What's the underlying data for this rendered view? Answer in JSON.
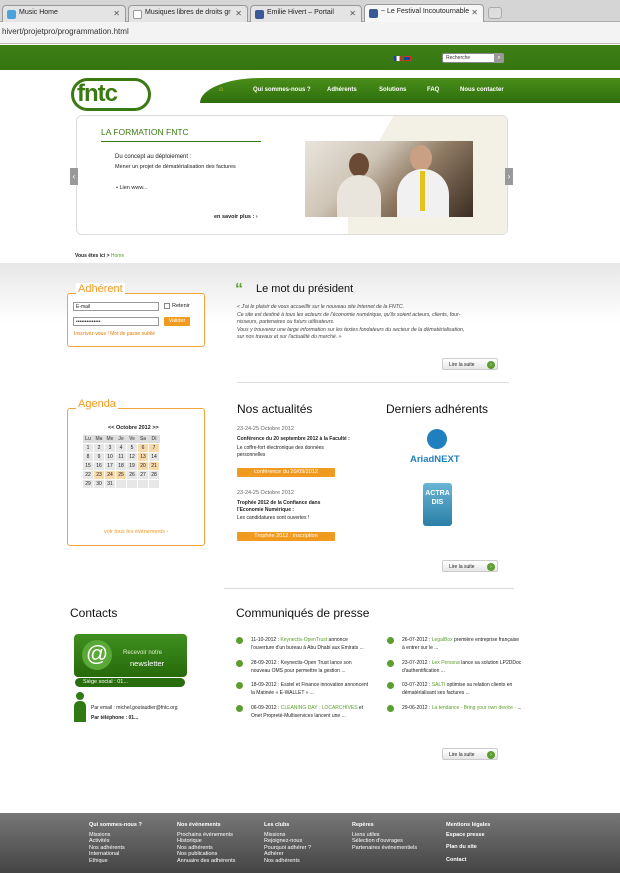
{
  "browser": {
    "tabs": [
      {
        "label": "Music Home",
        "color": "#4aa3df"
      },
      {
        "label": "Musiques libres de droits gr",
        "color": "#ffffff"
      },
      {
        "label": "Emilie Hivert – Portail",
        "color": "#3b5998"
      },
      {
        "label": "~ Le Festival Incoutournable",
        "color": "#3b5998"
      }
    ],
    "url": "hivert/projetpro/programmation.html"
  },
  "header": {
    "logo": "fntc",
    "search_placeholder": "Recherche",
    "nav": [
      "Qui sommes-nous ?",
      "Adhérents",
      "Solutions",
      "FAQ",
      "Nous contacter"
    ],
    "home_icon": "home-icon"
  },
  "slider": {
    "title": "LA FORMATION FNTC",
    "subtitle": "Du concept au déploiement :",
    "text": "Mener un projet de dématérialisation des factures",
    "bullet": "Lien www...",
    "more": "en savoir plus :"
  },
  "breadcrumb": {
    "label": "Vous êtes ici >",
    "current": "Home"
  },
  "adherent": {
    "title": "Adhérent",
    "email_value": "E-mail",
    "password_value": "••••••••••••••",
    "remember": "Retenir",
    "validate": "Valider",
    "links": "Inscrivez-vous ! Mot de passe oublié"
  },
  "president": {
    "title": "Le mot du président",
    "text": "« J'ai le plaisir de vous accueillir sur le nouveau site Internet de la FNTC.\nCe site est destiné à tous les acteurs de l'économie numérique, qu'ils soient acteurs, clients,  four-\nnisseurs, partenaires ou futurs utilisateurs.\nVous y trouverez une large information sur les textes fondateurs du secteur de la dématérialisation,\nsur nos travaux et sur l'actualité du marché. »",
    "more": "Lire la suite"
  },
  "agenda": {
    "title": "Agenda",
    "month": "<< Octobre 2012 >>",
    "days": [
      "Lu",
      "Ma",
      "Me",
      "Je",
      "Ve",
      "Sa",
      "Di"
    ],
    "weeks": [
      [
        "1",
        "2",
        "3",
        "4",
        "5",
        "6",
        "7"
      ],
      [
        "8",
        "9",
        "10",
        "11",
        "12",
        "13",
        "14"
      ],
      [
        "15",
        "16",
        "17",
        "18",
        "19",
        "20",
        "21"
      ],
      [
        "22",
        "23",
        "24",
        "25",
        "26",
        "27",
        "28"
      ],
      [
        "29",
        "30",
        "31",
        "",
        "",
        "",
        ""
      ]
    ],
    "events": [
      "6",
      "7",
      "13",
      "20",
      "21",
      "23",
      "24",
      "25"
    ],
    "link": "voir tous les événements"
  },
  "news": {
    "title": "Nos actualités",
    "items": [
      {
        "date": "23-24-25 Octobre 2012",
        "headline": "Conférence du 20 septembre 2012 à la Faculté :",
        "text": "Le coffre-fort électronique des données personnelles",
        "button": "conférence du 20/09/2012"
      },
      {
        "date": "23-24-25 Octobre 2012",
        "headline": "Trophée 2012 de la Confiance dans l'Economie Numérique :",
        "text": "Les candidatures sont ouvertes !",
        "button": "Trophée 2012 : inscription"
      }
    ]
  },
  "members": {
    "title": "Derniers adhérents",
    "logos": [
      "AriadNEXT",
      "ACTRADIS"
    ],
    "more": "Lire la suite"
  },
  "contacts": {
    "title": "Contacts",
    "newsletter_line1": "Recevoir notre",
    "newsletter_line2": "newsletter",
    "siege": "Siège social : 01...",
    "email": "Par email : michel.goutaudier@fntc.org",
    "phone": "Par téléphone : 01..."
  },
  "press": {
    "title": "Communiqués de presse",
    "left": [
      {
        "date": "11-10-2012 :",
        "company": "Keynectis-OpenTrust",
        "text": "annonce l'ouverture d'un bureau à Abu Dhabi aux Emirats ..."
      },
      {
        "date": "28-09-2012 :",
        "company": "",
        "text": "Keynectis-Open Trust lance son nouveau OMS pour permettre la gestion ..."
      },
      {
        "date": "18-09-2012 :",
        "company": "",
        "text": "Esstel et Finance innovation annoncent la Matinée « E-WALLET » ..."
      },
      {
        "date": "06-09-2012 :",
        "company": "CLEANING DAY : LOCARCHIVES",
        "text": "et Onet Propreté-Multiservices lancent une ..."
      }
    ],
    "right": [
      {
        "date": "26-07-2012 :",
        "company": "LegalBox",
        "text": "première entreprise française à entrer sur le ..."
      },
      {
        "date": "23-07-2012 :",
        "company": "Lex Persona",
        "text": "lance sa solution LP2DDoc d'authentification ..."
      },
      {
        "date": "03-07-2012 :",
        "company": "SALTI",
        "text": "optimise sa relation clients en dématérialisant ses factures ..."
      },
      {
        "date": "29-06-2012 :",
        "company": "La tendance - Bring your own device -",
        "text": "..."
      }
    ],
    "more": "Lire la suite"
  },
  "footer": {
    "cols": [
      {
        "title": "Qui sommes-nous ?",
        "items": [
          "Missions",
          "Activités",
          "Nos adhérents",
          "International",
          "Ethique"
        ]
      },
      {
        "title": "Nos événements",
        "items": [
          "Prochains événements",
          "Historique",
          "Nos adhérents",
          "Nos publications",
          "Annuaire des adhérents"
        ]
      },
      {
        "title": "Les clubs",
        "items": [
          "Missions",
          "Rejoignez-nous",
          "Pourquoi adhérer ?",
          "Adhérer",
          "Nos adhérents"
        ]
      },
      {
        "title": "Repères",
        "items": [
          "Liens utiles",
          "Sélection d'ouvrages",
          "Partenaires événementiels"
        ]
      },
      {
        "title": "Mentions légales",
        "items": [
          "Espace presse",
          "Plan du site",
          "Contact"
        ]
      }
    ]
  },
  "colors": {
    "brand": "#3a7a12",
    "accent": "#f19a20"
  }
}
